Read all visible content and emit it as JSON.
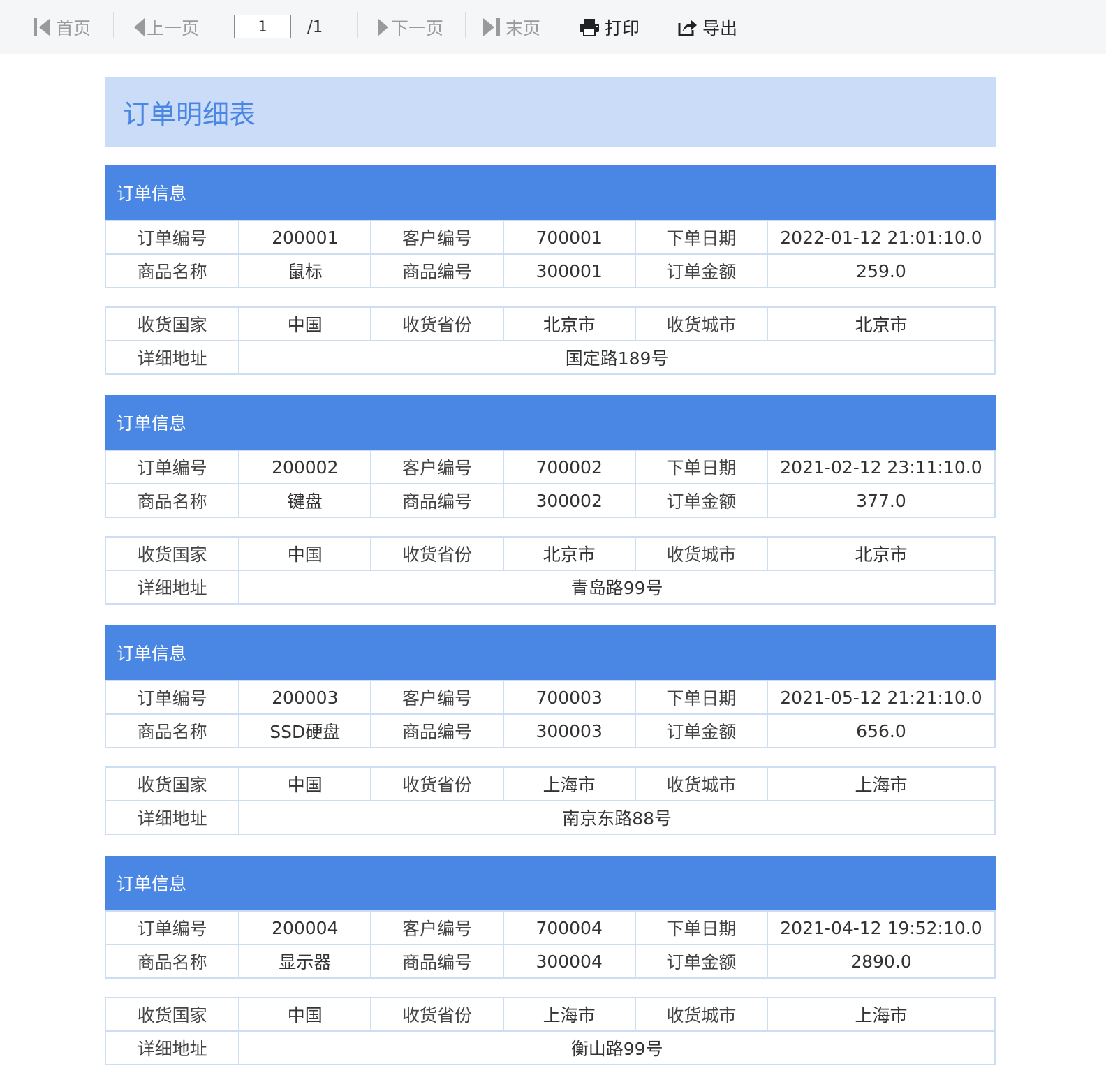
{
  "toolbar": {
    "first_label": "首页",
    "prev_label": "上一页",
    "page_current": "1",
    "page_total": "/1",
    "next_label": "下一页",
    "last_label": "末页",
    "print_label": "打印",
    "export_label": "导出"
  },
  "report": {
    "title": "订单明细表",
    "labels": {
      "section_header": "订单信息",
      "order_id": "订单编号",
      "customer_id": "客户编号",
      "order_date": "下单日期",
      "product_name": "商品名称",
      "product_id": "商品编号",
      "amount": "订单金额",
      "country": "收货国家",
      "province": "收货省份",
      "city": "收货城市",
      "address": "详细地址"
    },
    "orders": [
      {
        "order_id": "200001",
        "customer_id": "700001",
        "order_date": "2022-01-12 21:01:10.0",
        "product_name": "鼠标",
        "product_id": "300001",
        "amount": "259.0",
        "country": "中国",
        "province": "北京市",
        "city": "北京市",
        "address": "国定路189号"
      },
      {
        "order_id": "200002",
        "customer_id": "700002",
        "order_date": "2021-02-12 23:11:10.0",
        "product_name": "键盘",
        "product_id": "300002",
        "amount": "377.0",
        "country": "中国",
        "province": "北京市",
        "city": "北京市",
        "address": "青岛路99号"
      },
      {
        "order_id": "200003",
        "customer_id": "700003",
        "order_date": "2021-05-12 21:21:10.0",
        "product_name": "SSD硬盘",
        "product_id": "300003",
        "amount": "656.0",
        "country": "中国",
        "province": "上海市",
        "city": "上海市",
        "address": "南京东路88号"
      },
      {
        "order_id": "200004",
        "customer_id": "700004",
        "order_date": "2021-04-12 19:52:10.0",
        "product_name": "显示器",
        "product_id": "300004",
        "amount": "2890.0",
        "country": "中国",
        "province": "上海市",
        "city": "上海市",
        "address": "衡山路99号"
      }
    ]
  },
  "colors": {
    "accent": "#4a86e4",
    "banner": "#cadcf7",
    "cell_border": "#cdddf4",
    "toolbar_bg": "#f5f6f7"
  },
  "icons": {
    "first": "first-page-icon",
    "prev": "prev-page-icon",
    "next": "next-page-icon",
    "last": "last-page-icon",
    "print": "printer-icon",
    "export": "export-icon"
  }
}
